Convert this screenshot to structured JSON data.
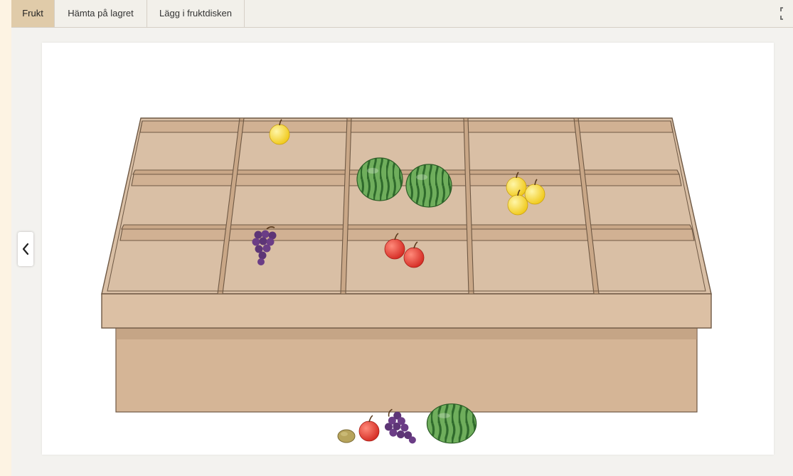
{
  "tabs": [
    {
      "label": "Frukt",
      "active": true
    },
    {
      "label": "Hämta på lagret",
      "active": false
    },
    {
      "label": "Lägg i fruktdisken",
      "active": false
    }
  ],
  "toolbar": {
    "fullscreen_icon": "fullscreen-icon"
  },
  "navigation": {
    "prev_icon": "chevron-left-icon"
  },
  "fruit_counter": {
    "rows": [
      [
        "empty",
        "yellow-apple",
        "empty",
        "empty",
        "empty"
      ],
      [
        "empty",
        "empty",
        "watermelon",
        "yellow-apple",
        "empty"
      ],
      [
        "empty",
        "grapes",
        "red-apple",
        "empty",
        "empty"
      ]
    ],
    "compartment_items": [
      {
        "row": 0,
        "col": 1,
        "fruit": "yellow-apple",
        "count": 1
      },
      {
        "row": 1,
        "col": 2,
        "fruit": "watermelon",
        "count": 2
      },
      {
        "row": 1,
        "col": 3,
        "fruit": "yellow-apple",
        "count": 3
      },
      {
        "row": 2,
        "col": 1,
        "fruit": "grapes",
        "count": 1
      },
      {
        "row": 2,
        "col": 2,
        "fruit": "red-apple",
        "count": 2
      }
    ]
  },
  "fruit_tray": [
    "kiwi",
    "red-apple",
    "grapes",
    "watermelon"
  ],
  "colors": {
    "accent_tab": "#e0cba9",
    "wood": "#d5b596",
    "wood_dark": "#c49f7d",
    "outline": "#6e5844",
    "watermelon_green": "#4f8f43",
    "apple_red": "#e23c31",
    "apple_yellow": "#f7dc3c",
    "grape_purple": "#5d3576",
    "kiwi_brown": "#b7a45c"
  }
}
